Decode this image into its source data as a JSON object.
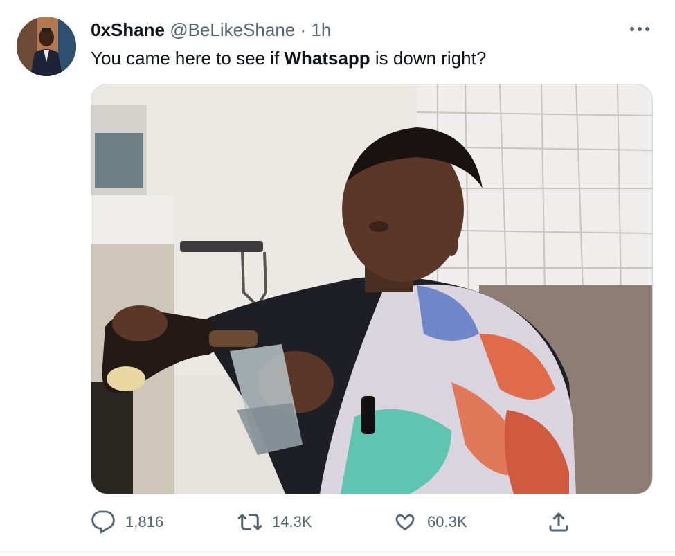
{
  "author": {
    "name": "0xShane",
    "handle": "@BeLikeShane",
    "separator": "·",
    "time": "1h"
  },
  "tweet": {
    "text_before": "You came here to see if ",
    "text_bold": "Whatsapp",
    "text_after": " is down right?"
  },
  "media": {
    "description_icon": "meme-photo"
  },
  "actions": {
    "replies": "1,816",
    "retweets": "14.3K",
    "likes": "60.3K"
  },
  "more_icon": "more-icon",
  "colors": {
    "text": "#0f1419",
    "secondary": "#536471",
    "border": "#cfd9de"
  }
}
